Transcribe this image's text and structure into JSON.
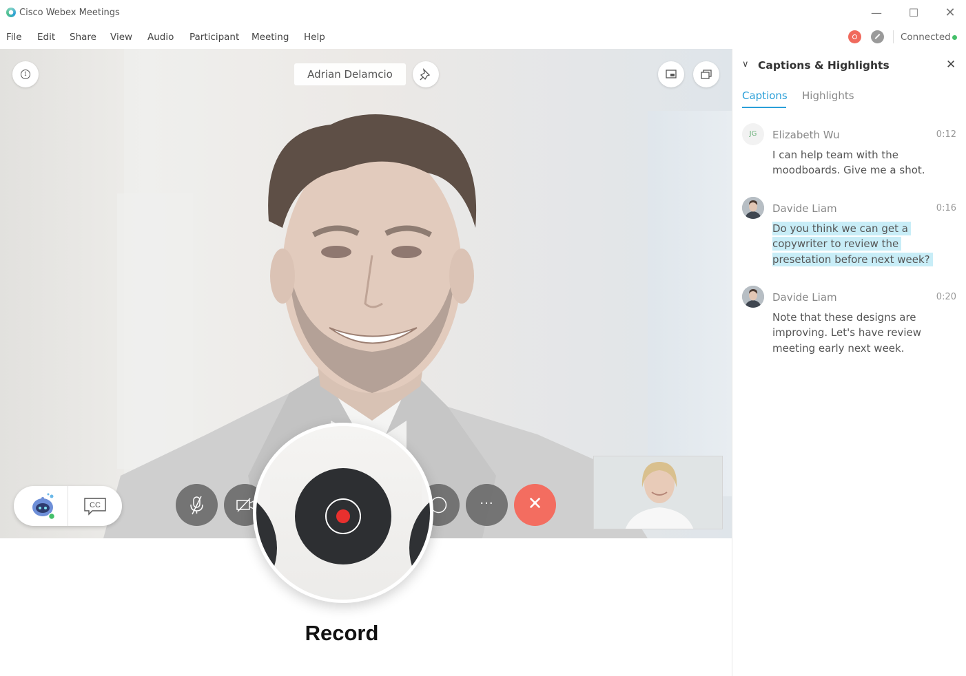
{
  "window": {
    "title": "Cisco Webex Meetings",
    "minimize_icon": "—",
    "maximize_icon": "☐",
    "close_icon": "✕"
  },
  "menu": {
    "items": [
      "File",
      "Edit",
      "Share",
      "View",
      "Audio",
      "Participant",
      "Meeting",
      "Help"
    ],
    "connection_status": "Connected"
  },
  "video": {
    "speaker_name": "Adrian Delamcio",
    "more_glyph": "···",
    "end_glyph": "✕",
    "cc_label": "CC"
  },
  "magnifier": {
    "label": "Record"
  },
  "panel": {
    "chevron": "∨",
    "title": "Captions & Highlights",
    "close": "✕",
    "tabs": [
      "Captions",
      "Highlights"
    ],
    "captions": [
      {
        "avatar": "JG",
        "name": "Elizabeth Wu",
        "time": "0:12",
        "text": "I can help team with the moodboards. Give me a shot.",
        "highlighted": false
      },
      {
        "avatar": "",
        "name": "Davide Liam",
        "time": "0:16",
        "text": "Do you think we can get a copywriter to review the presetation before next week?",
        "highlighted": true
      },
      {
        "avatar": "",
        "name": "Davide Liam",
        "time": "0:20",
        "text": "Note that these designs are improving. Let's have review meeting early next week.",
        "highlighted": false
      }
    ]
  },
  "colors": {
    "accent": "#2a9fd8",
    "end_call": "#f36d60",
    "record_dot": "#e8302e",
    "connected": "#44c06a",
    "caption_highlight": "#c8edf7"
  }
}
